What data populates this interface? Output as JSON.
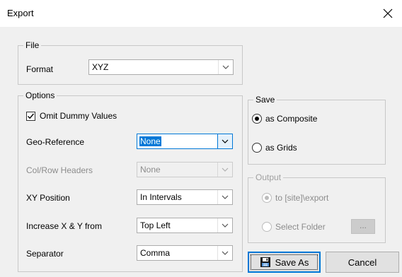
{
  "window": {
    "title": "Export"
  },
  "file_group": {
    "label": "File",
    "format_label": "Format",
    "format_value": "XYZ"
  },
  "options_group": {
    "label": "Options",
    "omit_dummy_label": "Omit Dummy Values",
    "omit_dummy_checked": true,
    "geo_reference_label": "Geo-Reference",
    "geo_reference_value": "None",
    "col_row_headers_label": "Col/Row Headers",
    "col_row_headers_value": "None",
    "xy_position_label": "XY Position",
    "xy_position_value": "In Intervals",
    "increase_label": "Increase X & Y from",
    "increase_value": "Top Left",
    "separator_label": "Separator",
    "separator_value": "Comma"
  },
  "save_group": {
    "label": "Save",
    "composite_label": "as Composite",
    "grids_label": "as Grids",
    "selected": "as Composite"
  },
  "output_group": {
    "label": "Output",
    "export_label": "to [site]\\export",
    "select_folder_label": "Select Folder",
    "browse_label": "...",
    "selected": "to [site]\\export"
  },
  "buttons": {
    "save_as_label": "Save As",
    "cancel_label": "Cancel"
  },
  "icons": {
    "close": "close-icon",
    "dropdown": "chevron-down-icon",
    "save": "floppy-disk-icon"
  },
  "colors": {
    "accent": "#0078d7",
    "selection": "#0078d7"
  }
}
